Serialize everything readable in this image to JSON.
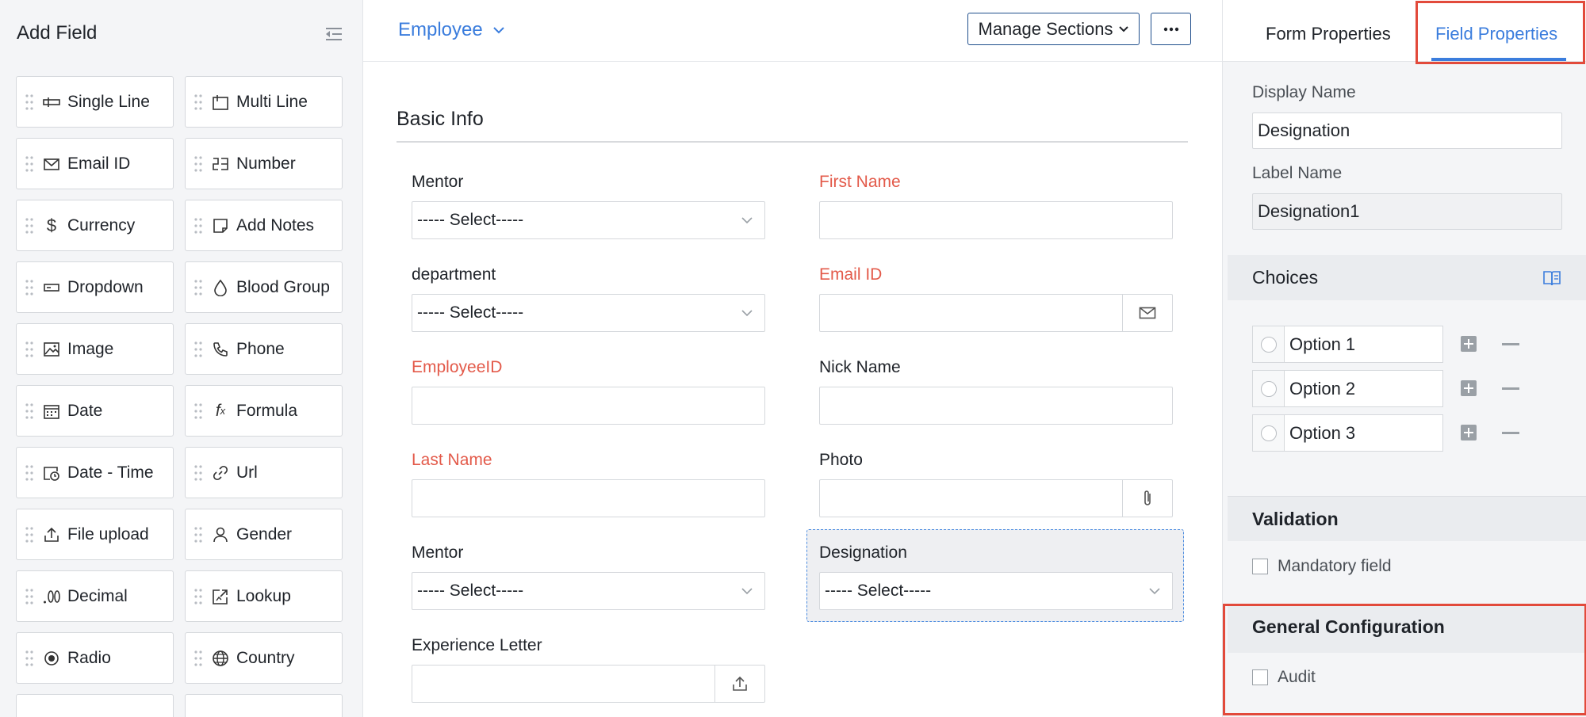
{
  "left_panel": {
    "title": "Add Field",
    "fields": [
      {
        "label": "Single Line",
        "icon": "single-line-icon"
      },
      {
        "label": "Multi Line",
        "icon": "multi-line-icon"
      },
      {
        "label": "Email ID",
        "icon": "email-icon"
      },
      {
        "label": "Number",
        "icon": "number-icon"
      },
      {
        "label": "Currency",
        "icon": "currency-icon"
      },
      {
        "label": "Add Notes",
        "icon": "notes-icon"
      },
      {
        "label": "Dropdown",
        "icon": "dropdown-icon"
      },
      {
        "label": "Blood Group",
        "icon": "drop-icon"
      },
      {
        "label": "Image",
        "icon": "image-icon"
      },
      {
        "label": "Phone",
        "icon": "phone-icon"
      },
      {
        "label": "Date",
        "icon": "calendar-icon"
      },
      {
        "label": "Formula",
        "icon": "formula-icon"
      },
      {
        "label": "Date - Time",
        "icon": "date-time-icon"
      },
      {
        "label": "Url",
        "icon": "link-icon"
      },
      {
        "label": "File upload",
        "icon": "upload-icon"
      },
      {
        "label": "Gender",
        "icon": "person-icon"
      },
      {
        "label": "Decimal",
        "icon": "decimal-icon"
      },
      {
        "label": "Lookup",
        "icon": "lookup-icon"
      },
      {
        "label": "Radio",
        "icon": "radio-icon"
      },
      {
        "label": "Country",
        "icon": "globe-icon"
      }
    ]
  },
  "header": {
    "form_name": "Employee",
    "manage_sections_label": "Manage Sections",
    "more_label": "···"
  },
  "form": {
    "section_title": "Basic Info",
    "select_placeholder": "----- Select-----",
    "fields": {
      "mentor_1": "Mentor",
      "first_name": "First Name",
      "department": "department",
      "email_id": "Email ID",
      "employee_id": "EmployeeID",
      "nick_name": "Nick Name",
      "last_name": "Last Name",
      "photo": "Photo",
      "mentor_2": "Mentor",
      "designation": "Designation",
      "experience_letter": "Experience Letter"
    }
  },
  "right_panel": {
    "tabs": {
      "form_properties": "Form Properties",
      "field_properties": "Field Properties"
    },
    "display_name_label": "Display Name",
    "display_name_value": "Designation",
    "label_name_label": "Label Name",
    "label_name_value": "Designation1",
    "choices_title": "Choices",
    "choices": [
      "Option 1",
      "Option 2",
      "Option 3"
    ],
    "validation_title": "Validation",
    "mandatory_label": "Mandatory field",
    "general_config_title": "General Configuration",
    "audit_label": "Audit"
  },
  "colors": {
    "accent": "#3b7ddd",
    "required": "#e35a4a",
    "highlight_box": "#e24a3b"
  }
}
